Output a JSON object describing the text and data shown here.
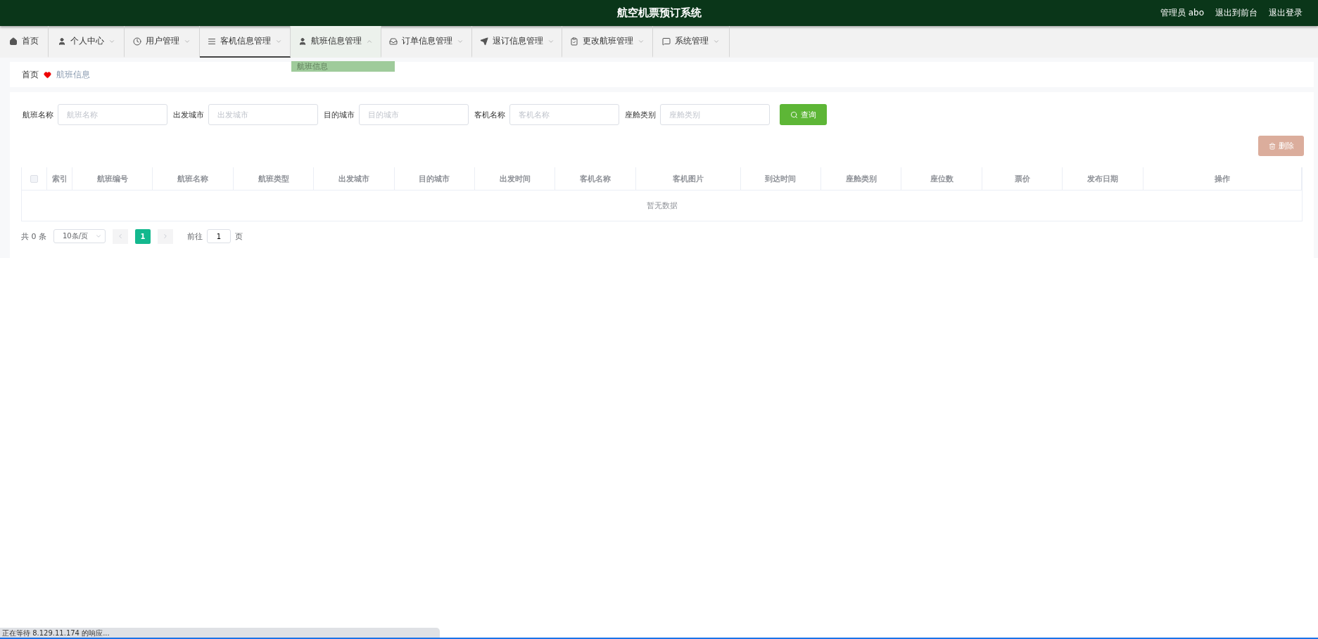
{
  "header": {
    "title": "航空机票预订系统",
    "links": [
      "管理员 abo",
      "退出到前台",
      "退出登录"
    ]
  },
  "nav": [
    {
      "label": "首页",
      "caret": false,
      "selected": false,
      "expanded": false
    },
    {
      "label": "个人中心",
      "caret": true,
      "selected": false,
      "expanded": false
    },
    {
      "label": "用户管理",
      "caret": true,
      "selected": false,
      "expanded": false
    },
    {
      "label": "客机信息管理",
      "caret": true,
      "selected": true,
      "expanded": false
    },
    {
      "label": "航班信息管理",
      "caret": true,
      "selected": false,
      "expanded": true,
      "menu": [
        "航班信息"
      ]
    },
    {
      "label": "订单信息管理",
      "caret": true,
      "selected": false,
      "expanded": false
    },
    {
      "label": "退订信息管理",
      "caret": true,
      "selected": false,
      "expanded": false
    },
    {
      "label": "更改航班管理",
      "caret": true,
      "selected": false,
      "expanded": false
    },
    {
      "label": "系统管理",
      "caret": true,
      "selected": false,
      "expanded": false
    }
  ],
  "breadcrumb": {
    "home": "首页",
    "current": "航班信息"
  },
  "filters": [
    {
      "label": "航班名称",
      "placeholder": "航班名称"
    },
    {
      "label": "出发城市",
      "placeholder": "出发城市"
    },
    {
      "label": "目的城市",
      "placeholder": "目的城市"
    },
    {
      "label": "客机名称",
      "placeholder": "客机名称"
    },
    {
      "label": "座舱类别",
      "placeholder": "座舱类别"
    }
  ],
  "search_button": "查询",
  "delete_button": "删除",
  "table": {
    "columns": [
      {
        "kind": "checkbox",
        "checked": false
      },
      {
        "kind": "index",
        "label": "索引"
      },
      {
        "kind": "field",
        "label": "航班编号"
      },
      {
        "kind": "field",
        "label": "航班名称"
      },
      {
        "kind": "field",
        "label": "航班类型"
      },
      {
        "kind": "field",
        "label": "出发城市"
      },
      {
        "kind": "field",
        "label": "目的城市"
      },
      {
        "kind": "field",
        "label": "出发时间"
      },
      {
        "kind": "field",
        "label": "客机名称"
      },
      {
        "kind": "image",
        "label": "客机图片"
      },
      {
        "kind": "field",
        "label": "到达时间"
      },
      {
        "kind": "field",
        "label": "座舱类别"
      },
      {
        "kind": "field",
        "label": "座位数"
      },
      {
        "kind": "field",
        "label": "票价"
      },
      {
        "kind": "field",
        "label": "发布日期"
      },
      {
        "kind": "actions",
        "label": "操作"
      }
    ],
    "empty_text": "暂无数据"
  },
  "pagination": {
    "total": "共 0 条",
    "page_size": "10条/页",
    "pages": [
      {
        "label": "1",
        "selected": true
      }
    ],
    "goto_label": "前往",
    "goto_value": "1",
    "goto_suffix": "页"
  },
  "status_bar": "正在等待 8.129.11.174 的响应..."
}
